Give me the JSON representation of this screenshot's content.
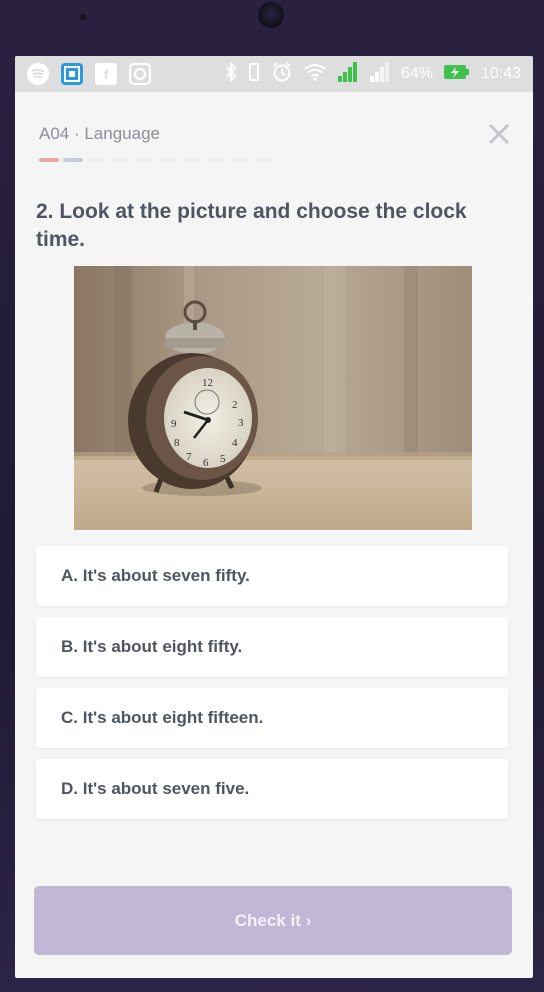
{
  "status_bar": {
    "battery": "64%",
    "time": "10:43",
    "left_icons": [
      "spotify-icon",
      "image-app-icon",
      "facebook-icon",
      "instagram-icon"
    ],
    "right_icons": [
      "bluetooth-icon",
      "vibrate-icon",
      "alarm-icon",
      "wifi-icon",
      "signal-icon",
      "signal-icon",
      "battery-charging-icon"
    ]
  },
  "header": {
    "lesson_title": "A04 · Language",
    "progress": {
      "current": 2,
      "total": 10,
      "colors": {
        "done": "#f2a5a8",
        "current": "#c6cbd6",
        "todo": "#eceef2"
      }
    }
  },
  "question": {
    "text": "2. Look at the picture and choose the clock time.",
    "image_subject": "alarm clock"
  },
  "options": [
    {
      "label": "A. It's about seven fifty."
    },
    {
      "label": "B. It's about eight fifty."
    },
    {
      "label": "C. It's about eight fifteen."
    },
    {
      "label": "D. It's about seven five."
    }
  ],
  "check_button": {
    "label": "Check it ›",
    "color": "#c0b8d4"
  }
}
